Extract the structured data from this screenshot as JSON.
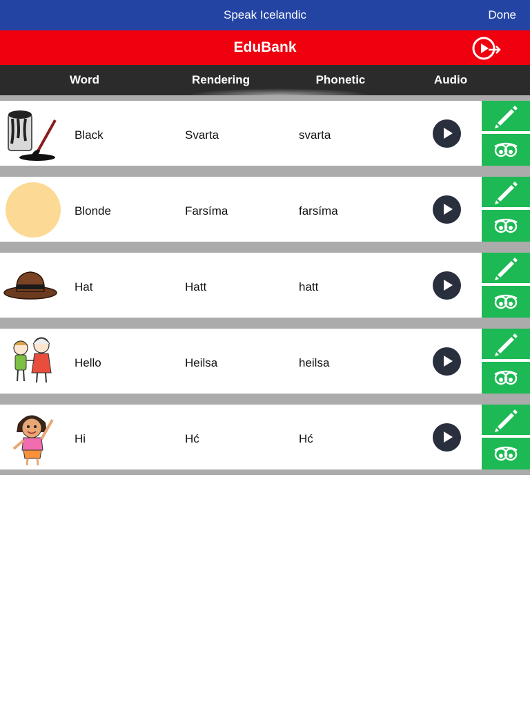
{
  "nav": {
    "title": "Speak Icelandic",
    "done_label": "Done"
  },
  "brand": {
    "title": "EduBank"
  },
  "columns": {
    "word": "Word",
    "rendering": "Rendering",
    "phonetic": "Phonetic",
    "audio": "Audio"
  },
  "rows": [
    {
      "word": "Black",
      "rendering": "Svarta",
      "phonetic": "svarta",
      "icon": "paint-bucket-icon"
    },
    {
      "word": "Blonde",
      "rendering": "Farsíma",
      "phonetic": "farsíma",
      "icon": "blonde-color-swatch"
    },
    {
      "word": "Hat",
      "rendering": "Hatt",
      "phonetic": "hatt",
      "icon": "hat-icon"
    },
    {
      "word": "Hello",
      "rendering": "Heilsa",
      "phonetic": "heilsa",
      "icon": "kids-hello-icon"
    },
    {
      "word": "Hi",
      "rendering": "Hć",
      "phonetic": "Hć",
      "icon": "girl-waving-icon"
    }
  ],
  "colors": {
    "nav": "#2444a4",
    "brand": "#f0000e",
    "header": "#2b2b2b",
    "action": "#1db954",
    "separator": "#ababab",
    "blonde": "#fcd994"
  }
}
